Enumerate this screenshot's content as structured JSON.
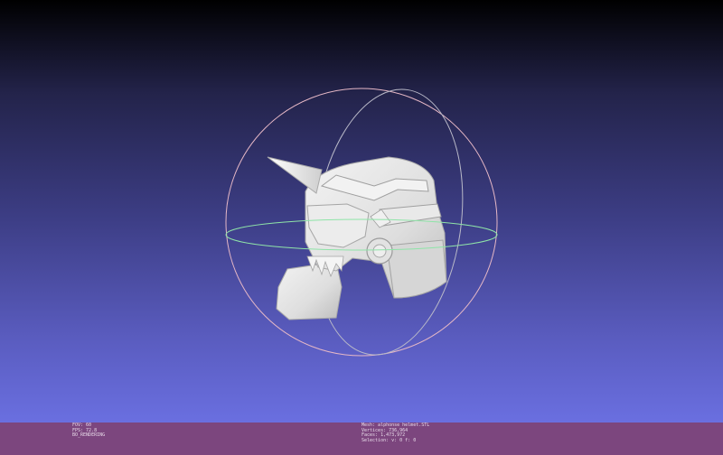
{
  "viewer": {
    "background_top": "#000000",
    "background_bottom": "#6a6fe0",
    "trackball": {
      "horizontal_ring_color": "#8fe4a8",
      "vertical_ring_color": "#b9b9c8",
      "side_ring_color": "#e6b8c6"
    },
    "model_color": "#e4e4e4"
  },
  "status": {
    "left": {
      "fov": "FOV: 60",
      "fps": "FPS:   72.8",
      "mode": "BO_RENDERING"
    },
    "right": {
      "mesh": "Mesh: alphonse helmet.STL",
      "vertices": "Vertices: 736,964",
      "faces": "Faces: 1,473,972",
      "selection": "Selection: v: 0 f: 0"
    },
    "bar_color": "#7c467e"
  }
}
